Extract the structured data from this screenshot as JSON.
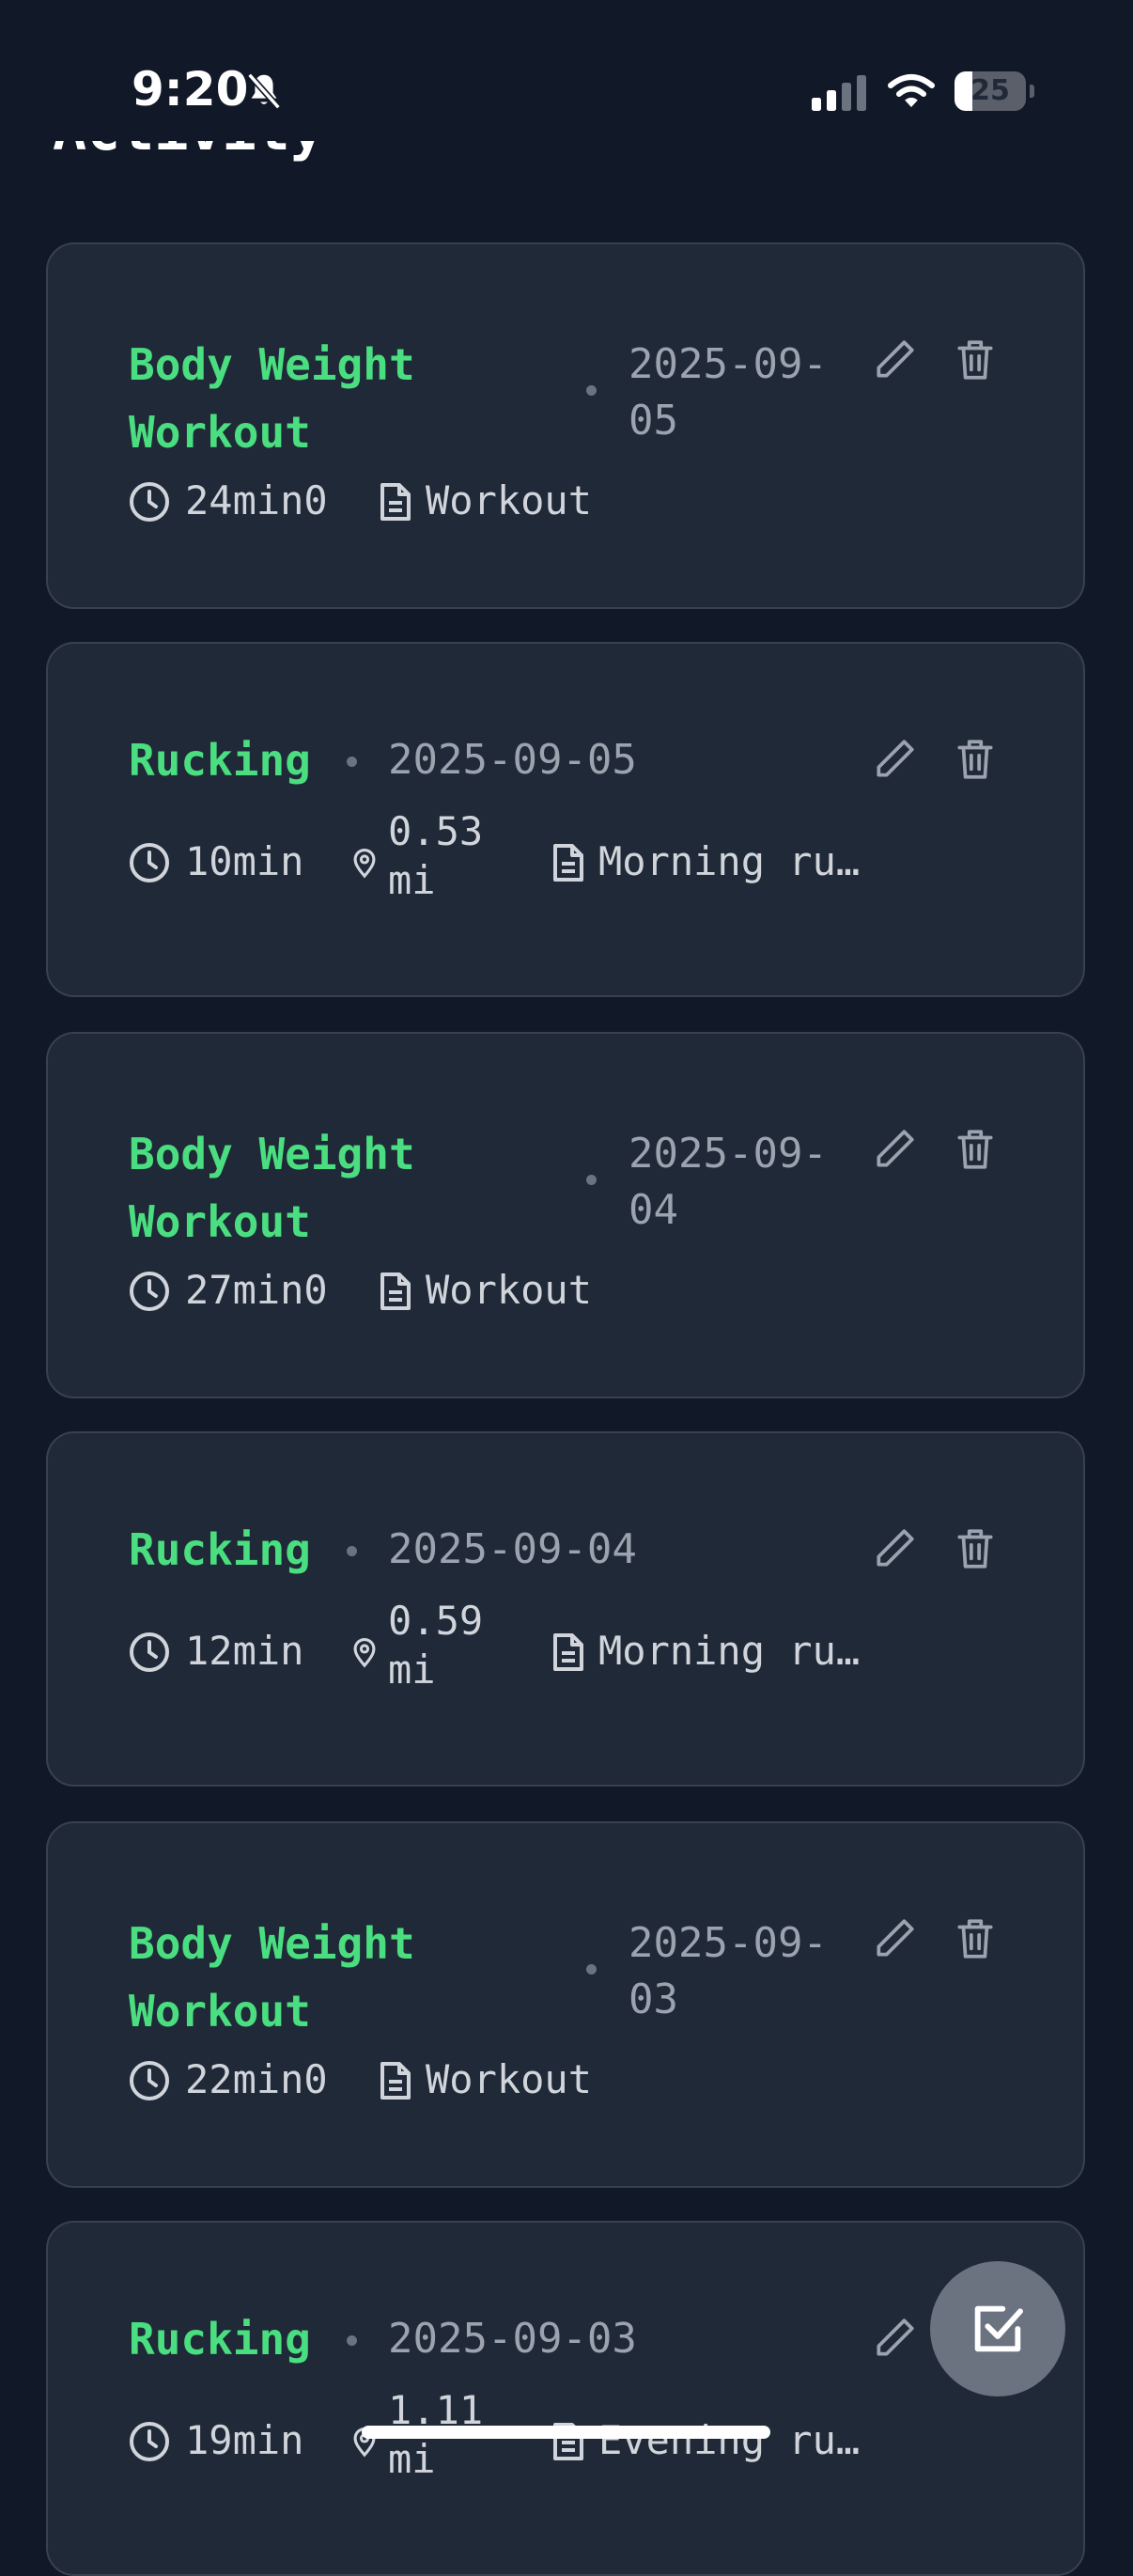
{
  "status_bar": {
    "time": "9:20",
    "battery_level": "25",
    "battery_fraction": 0.25,
    "icons": [
      "bell-slash-icon",
      "cellular-signal-icon",
      "wifi-icon",
      "battery-icon"
    ]
  },
  "header": {
    "partial_title": "Activity"
  },
  "activities": [
    {
      "name": "Body Weight Workout",
      "date": "2025-09-05",
      "duration": "24min0",
      "notes": "Workout"
    },
    {
      "name": "Rucking",
      "date": "2025-09-05",
      "duration": "10min",
      "distance": "0.53 mi",
      "notes": "Morning ru…"
    },
    {
      "name": "Body Weight Workout",
      "date": "2025-09-04",
      "duration": "27min0",
      "notes": "Workout"
    },
    {
      "name": "Rucking",
      "date": "2025-09-04",
      "duration": "12min",
      "distance": "0.59 mi",
      "notes": "Morning ru…"
    },
    {
      "name": "Body Weight Workout",
      "date": "2025-09-03",
      "duration": "22min0",
      "notes": "Workout"
    },
    {
      "name": "Rucking",
      "date": "2025-09-03",
      "duration": "19min",
      "distance": "1.11 mi",
      "notes": "Evening ru…"
    }
  ],
  "fab": {
    "icon": "check-square-icon"
  },
  "colors": {
    "background": "#111827",
    "card": "#1f2937",
    "card_border": "#374151",
    "accent_green": "#4ade80",
    "muted_text": "#9ca3af",
    "fab": "#6b7280"
  }
}
